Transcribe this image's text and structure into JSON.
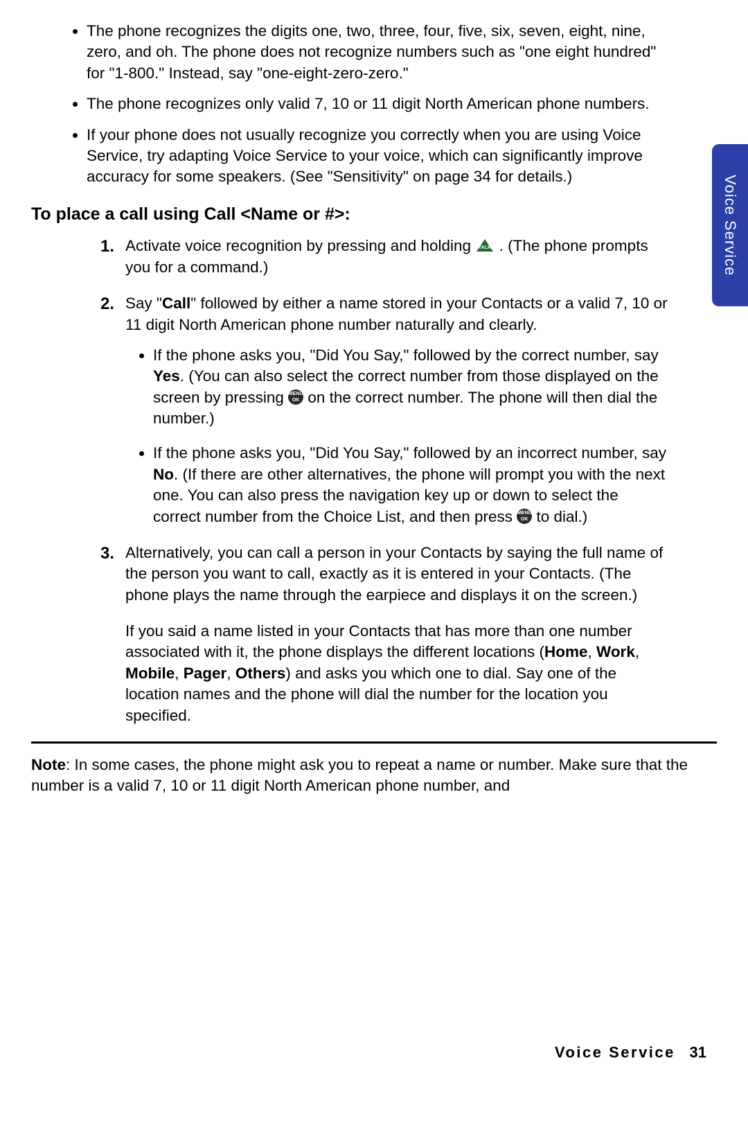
{
  "sideTab": "Voice Service",
  "bullets": [
    "The phone recognizes the digits one, two, three, four, five, six, seven, eight, nine, zero, and oh. The phone does not recognize numbers such as \"one eight hundred\" for \"1-800.\" Instead, say \"one-eight-zero-zero.\"",
    "The phone recognizes only valid 7, 10 or 11 digit North American phone numbers.",
    "If your phone does not usually recognize you correctly when you are using Voice Service, try adapting Voice Service to your voice, which can significantly improve accuracy for some speakers. (See \"Sensitivity\" on page 34 for details.)"
  ],
  "heading": "To place a call using Call <Name or #>:",
  "step1": {
    "num": "1.",
    "a": "Activate voice recognition by pressing and holding ",
    "b": ". (The phone prompts you for a command.)"
  },
  "step2": {
    "num": "2.",
    "a": "Say \"",
    "call": "Call",
    "b": "\" followed by either a name stored in your Contacts or a valid 7, 10 or 11 digit North American phone number naturally and clearly.",
    "sub1": {
      "a": "If the phone asks you, \"Did You Say,\" followed by the correct number, say ",
      "yes": "Yes",
      "b": ". (You can also select the correct number from those displayed on the screen by pressing ",
      "c": " on the correct number. The phone will then dial the number.)"
    },
    "sub2": {
      "a": "If the phone asks you, \"Did You Say,\" followed by an incorrect number, say ",
      "no": "No",
      "b": ". (If there are other alternatives, the phone will prompt you with the next one. You can also press the navigation key up or down to select the correct number from the Choice List, and then press ",
      "c": " to dial.)"
    }
  },
  "step3": {
    "num": "3.",
    "p1": "Alternatively, you can call a person in your Contacts by saying the full name of the person you want to call, exactly as it is entered in your Contacts. (The phone plays the name through the earpiece and displays it on the screen.)",
    "p2a": "If you said a name listed in your Contacts that has more than one number associated with it, the phone displays the different locations (",
    "homes": "Home",
    "work": "Work",
    "mobile": "Mobile",
    "pager": "Pager",
    "others": "Others",
    "p2b": ") and asks you which one to dial. Say one of the location names and the phone will dial the number for the location you specified.",
    "sep": ", "
  },
  "note": {
    "label": "Note",
    "text": ": In some cases, the phone might ask you to repeat a name or number. Make sure that the number is a valid 7, 10 or 11 digit North American phone number, and"
  },
  "footer": {
    "section": "Voice Service",
    "page": "31"
  },
  "iconOk": "MENU\nOK"
}
